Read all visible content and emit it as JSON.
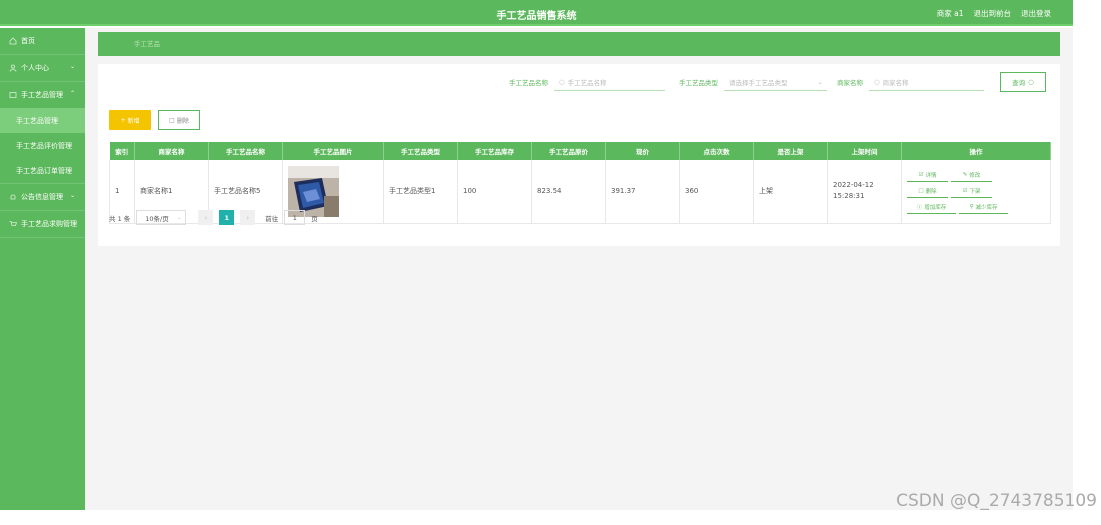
{
  "header": {
    "title": "手工艺品销售系统",
    "user": "商家 a1",
    "back_to_front": "退出到前台",
    "logout": "退出登录"
  },
  "sidebar": {
    "items": [
      {
        "label": "首页",
        "icon": "home-icon"
      },
      {
        "label": "个人中心",
        "icon": "user-icon",
        "expandable": true
      },
      {
        "label": "手工艺品管理",
        "icon": "box-icon",
        "expanded": true,
        "children": [
          {
            "label": "手工艺品管理",
            "active": true
          },
          {
            "label": "手工艺品评价管理"
          },
          {
            "label": "手工艺品订单管理"
          }
        ]
      },
      {
        "label": "公告信息管理",
        "icon": "bell-icon",
        "expandable": true
      },
      {
        "label": "手工艺品求购管理",
        "icon": "cart-icon"
      }
    ]
  },
  "breadcrumb": {
    "current": "手工艺品"
  },
  "search": {
    "name_label": "手工艺品名称",
    "name_placeholder": "手工艺品名称",
    "type_label": "手工艺品类型",
    "type_placeholder": "请选择手工艺品类型",
    "merchant_label": "商家名称",
    "merchant_placeholder": "商家名称",
    "query_button": "查询"
  },
  "toolbar": {
    "add_label": "新增",
    "delete_label": "删除"
  },
  "table": {
    "headers": [
      "索引",
      "商家名称",
      "手工艺品名称",
      "手工艺品图片",
      "手工艺品类型",
      "手工艺品库存",
      "手工艺品原价",
      "现价",
      "点击次数",
      "是否上架",
      "上架时间",
      "操作"
    ],
    "rows": [
      {
        "index": "1",
        "merchant": "商家名称1",
        "name": "手工艺品名称5",
        "type": "手工艺品类型1",
        "stock": "100",
        "original_price": "823.54",
        "price": "391.37",
        "clicks": "360",
        "on_shelf": "上架",
        "time": "2022-04-12 15:28:31"
      }
    ],
    "actions": {
      "detail": "详情",
      "edit": "修改",
      "delete": "删除",
      "off_shelf": "下架",
      "add_stock": "增加库存",
      "reduce_stock": "减少库存"
    }
  },
  "pagination": {
    "total": "共 1 条",
    "page_size": "10条/页",
    "current_page": "1",
    "goto_label": "前往",
    "goto_value": "1",
    "page_unit": "页"
  },
  "watermark": "CSDN @Q_2743785109",
  "colors": {
    "primary": "#5cb85c",
    "accent": "#f5c400",
    "page_active": "#20b2aa"
  }
}
